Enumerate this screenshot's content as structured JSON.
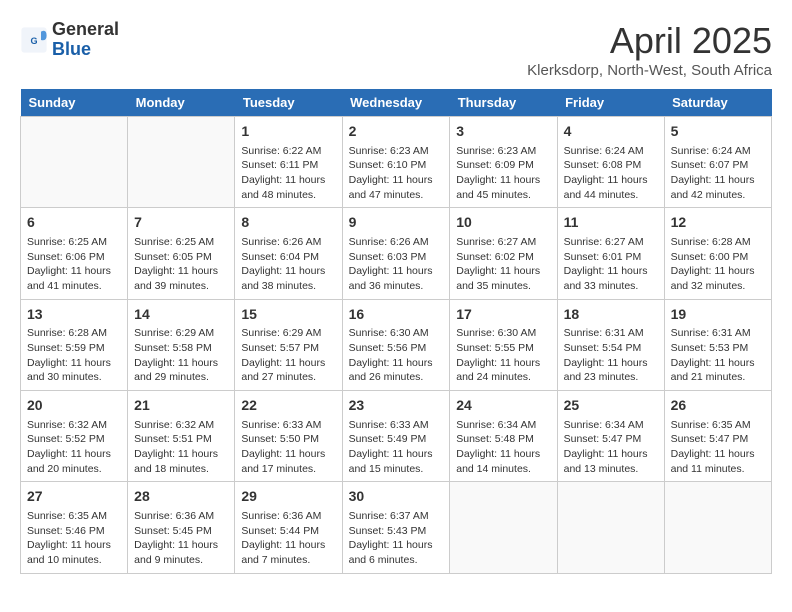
{
  "header": {
    "logo_general": "General",
    "logo_blue": "Blue",
    "month_year": "April 2025",
    "location": "Klerksdorp, North-West, South Africa"
  },
  "weekdays": [
    "Sunday",
    "Monday",
    "Tuesday",
    "Wednesday",
    "Thursday",
    "Friday",
    "Saturday"
  ],
  "weeks": [
    [
      {
        "day": "",
        "info": ""
      },
      {
        "day": "",
        "info": ""
      },
      {
        "day": "1",
        "info": "Sunrise: 6:22 AM\nSunset: 6:11 PM\nDaylight: 11 hours and 48 minutes."
      },
      {
        "day": "2",
        "info": "Sunrise: 6:23 AM\nSunset: 6:10 PM\nDaylight: 11 hours and 47 minutes."
      },
      {
        "day": "3",
        "info": "Sunrise: 6:23 AM\nSunset: 6:09 PM\nDaylight: 11 hours and 45 minutes."
      },
      {
        "day": "4",
        "info": "Sunrise: 6:24 AM\nSunset: 6:08 PM\nDaylight: 11 hours and 44 minutes."
      },
      {
        "day": "5",
        "info": "Sunrise: 6:24 AM\nSunset: 6:07 PM\nDaylight: 11 hours and 42 minutes."
      }
    ],
    [
      {
        "day": "6",
        "info": "Sunrise: 6:25 AM\nSunset: 6:06 PM\nDaylight: 11 hours and 41 minutes."
      },
      {
        "day": "7",
        "info": "Sunrise: 6:25 AM\nSunset: 6:05 PM\nDaylight: 11 hours and 39 minutes."
      },
      {
        "day": "8",
        "info": "Sunrise: 6:26 AM\nSunset: 6:04 PM\nDaylight: 11 hours and 38 minutes."
      },
      {
        "day": "9",
        "info": "Sunrise: 6:26 AM\nSunset: 6:03 PM\nDaylight: 11 hours and 36 minutes."
      },
      {
        "day": "10",
        "info": "Sunrise: 6:27 AM\nSunset: 6:02 PM\nDaylight: 11 hours and 35 minutes."
      },
      {
        "day": "11",
        "info": "Sunrise: 6:27 AM\nSunset: 6:01 PM\nDaylight: 11 hours and 33 minutes."
      },
      {
        "day": "12",
        "info": "Sunrise: 6:28 AM\nSunset: 6:00 PM\nDaylight: 11 hours and 32 minutes."
      }
    ],
    [
      {
        "day": "13",
        "info": "Sunrise: 6:28 AM\nSunset: 5:59 PM\nDaylight: 11 hours and 30 minutes."
      },
      {
        "day": "14",
        "info": "Sunrise: 6:29 AM\nSunset: 5:58 PM\nDaylight: 11 hours and 29 minutes."
      },
      {
        "day": "15",
        "info": "Sunrise: 6:29 AM\nSunset: 5:57 PM\nDaylight: 11 hours and 27 minutes."
      },
      {
        "day": "16",
        "info": "Sunrise: 6:30 AM\nSunset: 5:56 PM\nDaylight: 11 hours and 26 minutes."
      },
      {
        "day": "17",
        "info": "Sunrise: 6:30 AM\nSunset: 5:55 PM\nDaylight: 11 hours and 24 minutes."
      },
      {
        "day": "18",
        "info": "Sunrise: 6:31 AM\nSunset: 5:54 PM\nDaylight: 11 hours and 23 minutes."
      },
      {
        "day": "19",
        "info": "Sunrise: 6:31 AM\nSunset: 5:53 PM\nDaylight: 11 hours and 21 minutes."
      }
    ],
    [
      {
        "day": "20",
        "info": "Sunrise: 6:32 AM\nSunset: 5:52 PM\nDaylight: 11 hours and 20 minutes."
      },
      {
        "day": "21",
        "info": "Sunrise: 6:32 AM\nSunset: 5:51 PM\nDaylight: 11 hours and 18 minutes."
      },
      {
        "day": "22",
        "info": "Sunrise: 6:33 AM\nSunset: 5:50 PM\nDaylight: 11 hours and 17 minutes."
      },
      {
        "day": "23",
        "info": "Sunrise: 6:33 AM\nSunset: 5:49 PM\nDaylight: 11 hours and 15 minutes."
      },
      {
        "day": "24",
        "info": "Sunrise: 6:34 AM\nSunset: 5:48 PM\nDaylight: 11 hours and 14 minutes."
      },
      {
        "day": "25",
        "info": "Sunrise: 6:34 AM\nSunset: 5:47 PM\nDaylight: 11 hours and 13 minutes."
      },
      {
        "day": "26",
        "info": "Sunrise: 6:35 AM\nSunset: 5:47 PM\nDaylight: 11 hours and 11 minutes."
      }
    ],
    [
      {
        "day": "27",
        "info": "Sunrise: 6:35 AM\nSunset: 5:46 PM\nDaylight: 11 hours and 10 minutes."
      },
      {
        "day": "28",
        "info": "Sunrise: 6:36 AM\nSunset: 5:45 PM\nDaylight: 11 hours and 9 minutes."
      },
      {
        "day": "29",
        "info": "Sunrise: 6:36 AM\nSunset: 5:44 PM\nDaylight: 11 hours and 7 minutes."
      },
      {
        "day": "30",
        "info": "Sunrise: 6:37 AM\nSunset: 5:43 PM\nDaylight: 11 hours and 6 minutes."
      },
      {
        "day": "",
        "info": ""
      },
      {
        "day": "",
        "info": ""
      },
      {
        "day": "",
        "info": ""
      }
    ]
  ]
}
